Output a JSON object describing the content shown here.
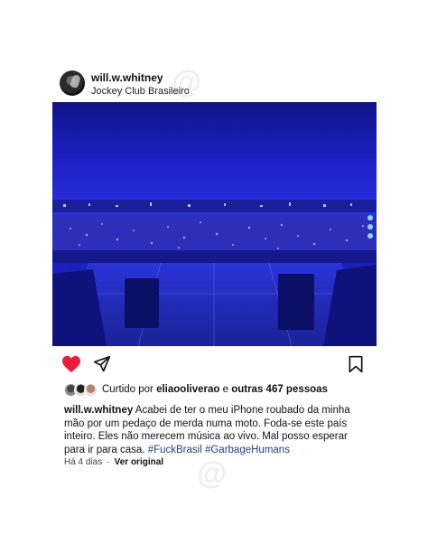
{
  "post": {
    "username": "will.w.whitney",
    "location": "Jockey Club Brasileiro"
  },
  "likes": {
    "prefix": "Curtido por ",
    "first_user": "eliaooliverao",
    "connector": " e ",
    "others": "outras 467 pessoas"
  },
  "caption": {
    "author": "will.w.whitney",
    "text": " Acabei de ter o meu iPhone roubado da minha mão por um pedaço de merda numa moto. Foda-se este país inteiro. Eles não merecem música ao vivo. Mal posso esperar para ir para casa. ",
    "hashtags": [
      "#FuckBrasil",
      "#GarbageHumans"
    ]
  },
  "meta": {
    "time": "Há 4 dias",
    "separator": "·",
    "see_original": "Ver original"
  },
  "icons": {
    "like": "heart-icon",
    "share": "send-icon",
    "save": "bookmark-icon"
  },
  "colors": {
    "heart": "#ed1c3a",
    "hashtag": "#1d3f8a",
    "stage_blue": "#2328d8"
  }
}
